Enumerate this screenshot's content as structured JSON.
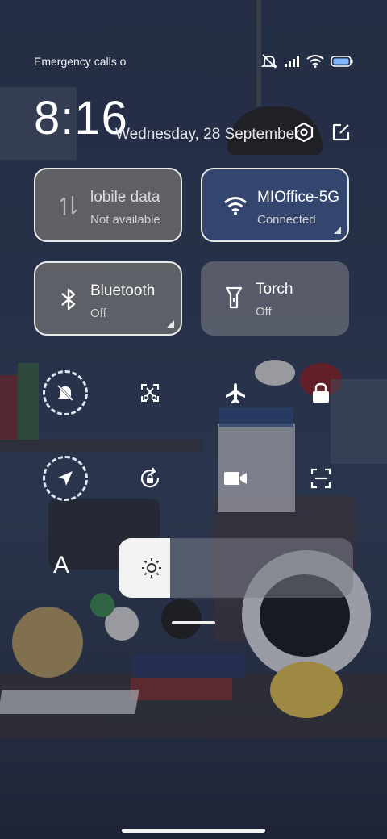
{
  "status": {
    "carrier_text": "Emergency calls o",
    "icons": [
      "dnd-muted-icon",
      "signal-icon",
      "wifi-icon",
      "battery-icon"
    ]
  },
  "header": {
    "time": "8:16",
    "date": "Wednesday, 28 September",
    "settings_icon": "hexagon-settings-icon",
    "edit_icon": "edit-icon"
  },
  "tiles": {
    "mobile_data": {
      "name": "lobile data",
      "sub": "Not available",
      "icon": "data-arrows-icon"
    },
    "wifi": {
      "name": "MIOffice-5G",
      "sub": "Connected",
      "icon": "wifi-icon"
    },
    "bluetooth": {
      "name": "Bluetooth",
      "sub": "Off",
      "icon": "bluetooth-icon"
    },
    "torch": {
      "name": "Torch",
      "sub": "Off",
      "icon": "torch-icon"
    }
  },
  "toggles_row1": [
    "mute-bell-icon",
    "screenshot-icon",
    "airplane-icon",
    "lock-icon"
  ],
  "toggles_row2": [
    "location-icon",
    "auto-rotate-icon",
    "screen-record-icon",
    "scanner-icon"
  ],
  "brightness": {
    "auto_label": "A",
    "level": 0.22
  },
  "colors": {
    "active_tile": "#34466e",
    "inactive_tile": "#6e6e70"
  }
}
